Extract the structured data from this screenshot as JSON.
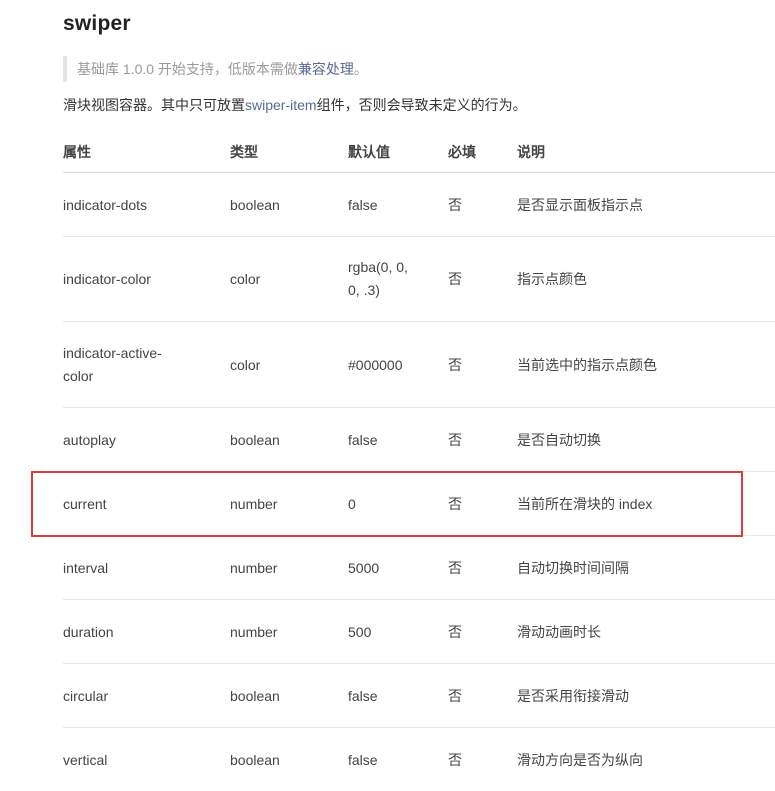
{
  "page": {
    "title": "swiper",
    "note_prefix": "基础库 1.0.0 开始支持，低版本需做",
    "note_link": "兼容处理",
    "note_suffix": "。",
    "desc_prefix": "滑块视图容器。其中只可放置",
    "desc_link": "swiper-item",
    "desc_suffix": "组件，否则会导致未定义的行为。"
  },
  "table": {
    "headers": [
      "属性",
      "类型",
      "默认值",
      "必填",
      "说明"
    ],
    "rows": [
      {
        "name": "indicator-dots",
        "type": "boolean",
        "default": "false",
        "required": "否",
        "desc": "是否显示面板指示点"
      },
      {
        "name": "indicator-color",
        "type": "color",
        "default": "rgba(0, 0, 0, .3)",
        "required": "否",
        "desc": "指示点颜色"
      },
      {
        "name": "indicator-active-color",
        "type": "color",
        "default": "#000000",
        "required": "否",
        "desc": "当前选中的指示点颜色"
      },
      {
        "name": "autoplay",
        "type": "boolean",
        "default": "false",
        "required": "否",
        "desc": "是否自动切换"
      },
      {
        "name": "current",
        "type": "number",
        "default": "0",
        "required": "否",
        "desc": "当前所在滑块的 index"
      },
      {
        "name": "interval",
        "type": "number",
        "default": "5000",
        "required": "否",
        "desc": "自动切换时间间隔"
      },
      {
        "name": "duration",
        "type": "number",
        "default": "500",
        "required": "否",
        "desc": "滑动动画时长"
      },
      {
        "name": "circular",
        "type": "boolean",
        "default": "false",
        "required": "否",
        "desc": "是否采用衔接滑动"
      },
      {
        "name": "vertical",
        "type": "boolean",
        "default": "false",
        "required": "否",
        "desc": "滑动方向是否为纵向"
      }
    ]
  },
  "colors": {
    "link": "#576b95",
    "highlight_border": "#e0393c",
    "note_text": "#9a9a9a"
  }
}
